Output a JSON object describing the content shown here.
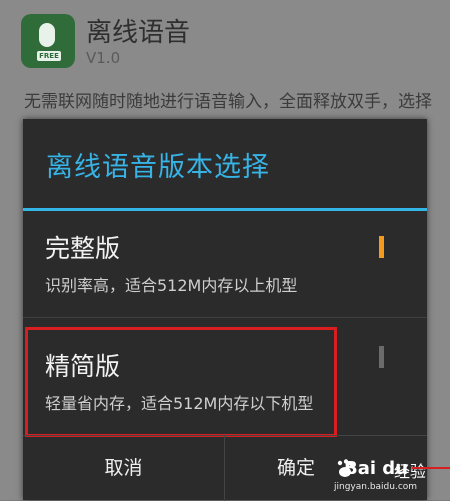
{
  "background_app": {
    "title": "离线语音",
    "version": "V1.0",
    "icon_badge": "FREE",
    "description": "无需联网随时随地进行语音输入，全面释放双手，选择更省流量"
  },
  "dialog": {
    "title": "离线语音版本选择",
    "options": [
      {
        "name": "完整版",
        "description": "识别率高，适合512M内存以上机型",
        "selected": true
      },
      {
        "name": "精简版",
        "description": "轻量省内存，适合512M内存以下机型",
        "selected": false
      }
    ],
    "buttons": {
      "cancel": "取消",
      "ok": "确定"
    }
  },
  "watermark": {
    "logo": "Bai du",
    "suffix": "经验",
    "url": "jingyan.baidu.com"
  },
  "colors": {
    "accent": "#33b5e5",
    "selected_indicator": "#f39a1f",
    "highlight_box": "#d81e1e",
    "dialog_bg": "#2b2b2b"
  }
}
